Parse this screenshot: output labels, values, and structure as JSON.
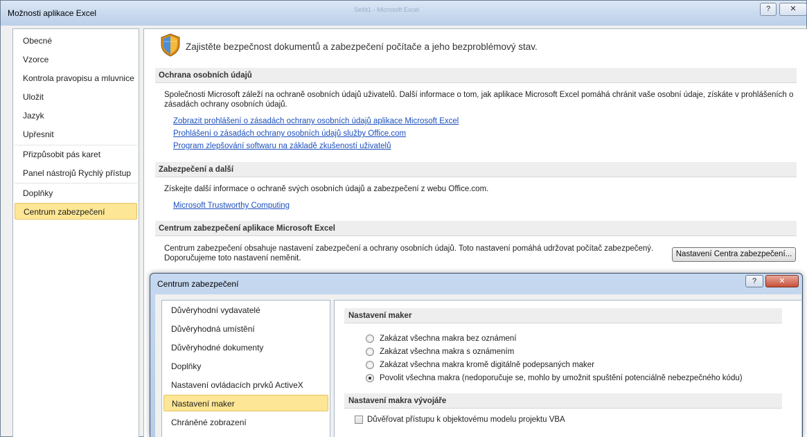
{
  "window": {
    "title": "Možnosti aplikace Excel",
    "bg_title": "Sešit1 - Microsoft Excel",
    "help_label": "?",
    "close_label": "✕"
  },
  "nav": {
    "items": [
      "Obecné",
      "Vzorce",
      "Kontrola pravopisu a mluvnice",
      "Uložit",
      "Jazyk",
      "Upřesnit",
      "Přizpůsobit pás karet",
      "Panel nástrojů Rychlý přístup",
      "Doplňky",
      "Centrum zabezpečení"
    ],
    "selected": "Centrum zabezpečení"
  },
  "content": {
    "intro": "Zajistěte bezpečnost dokumentů a zabezpečení počítače a jeho bezproblémový stav.",
    "privacy": {
      "heading": "Ochrana osobních údajů",
      "text1": "Společnosti Microsoft záleží na ochraně osobních údajů uživatelů. Další informace o tom, jak aplikace Microsoft Excel pomáhá chránit vaše osobní údaje, získáte v prohlášeních o",
      "text2": "zásadách ochrany osobních údajů.",
      "links": [
        "Zobrazit prohlášení o zásadách ochrany osobních údajů aplikace Microsoft Excel",
        "Prohlášení o zásadách ochrany osobních údajů služby Office.com",
        "Program zlepšování softwaru na základě zkušeností uživatelů"
      ]
    },
    "security": {
      "heading": "Zabezpečení a další",
      "text": "Získejte další informace o ochraně svých osobních údajů a zabezpečení z webu Office.com.",
      "link": "Microsoft Trustworthy Computing"
    },
    "trust_center": {
      "heading": "Centrum zabezpečení aplikace Microsoft Excel",
      "text1": "Centrum zabezpečení obsahuje nastavení zabezpečení a ochrany osobních údajů. Toto nastavení pomáhá udržovat počítač zabezpečený.",
      "text2": "Doporučujeme toto nastavení neměnit.",
      "button": "Nastavení Centra zabezpečení..."
    }
  },
  "tc_dialog": {
    "title": "Centrum zabezpečení",
    "help_label": "?",
    "close_label": "✕",
    "nav": [
      "Důvěryhodní vydavatelé",
      "Důvěryhodná umístění",
      "Důvěryhodné dokumenty",
      "Doplňky",
      "Nastavení ovládacích prvků ActiveX",
      "Nastavení maker",
      "Chráněné zobrazení"
    ],
    "selected": "Nastavení maker",
    "macro_heading": "Nastavení maker",
    "macro_options": [
      "Zakázat všechna makra bez oznámení",
      "Zakázat všechna makra s oznámením",
      "Zakázat všechna makra kromě digitálně podepsaných maker",
      "Povolit všechna makra (nedoporučuje se, mohlo by umožnit spuštění potenciálně nebezpečného kódu)"
    ],
    "macro_selected_index": 3,
    "dev_heading": "Nastavení makra vývojáře",
    "dev_checkbox": "Důvěřovat přístupu k objektovému modelu projektu VBA",
    "dev_checked": false
  },
  "colors": {
    "selection": "#fde695",
    "link": "#1b4fbc"
  }
}
